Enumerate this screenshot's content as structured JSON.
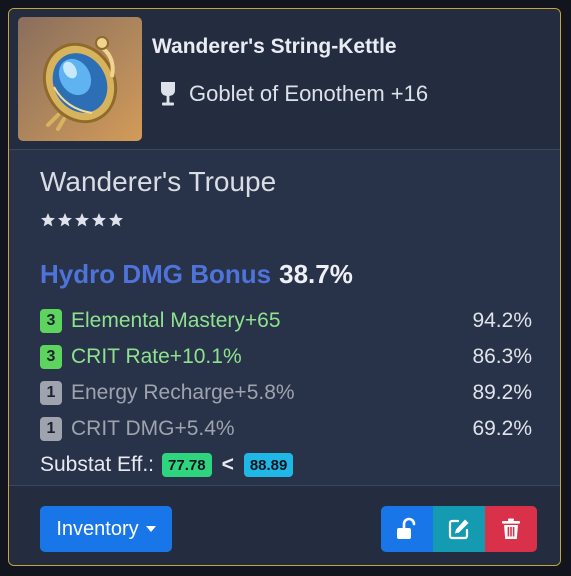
{
  "artifact": {
    "name": "Wanderer's String-Kettle",
    "slot": "Goblet of Eonothem +16",
    "slot_icon": "goblet-icon",
    "image_icon": "artifact-goblet-image",
    "set": "Wanderer's Troupe",
    "rarity_stars": 5,
    "main_stat": {
      "name": "Hydro DMG Bonus",
      "value": "38.7%",
      "color": "#4f74d9"
    },
    "substats": [
      {
        "rolls": "3",
        "text": "Elemental Mastery+65",
        "pct": "94.2%",
        "tier": "high"
      },
      {
        "rolls": "3",
        "text": "CRIT Rate+10.1%",
        "pct": "86.3%",
        "tier": "high"
      },
      {
        "rolls": "1",
        "text": "Energy Recharge+5.8%",
        "pct": "89.2%",
        "tier": "low"
      },
      {
        "rolls": "1",
        "text": "CRIT DMG+5.4%",
        "pct": "69.2%",
        "tier": "low"
      }
    ],
    "efficiency": {
      "label": "Substat Eff.:",
      "current": "77.78",
      "comparator": "<",
      "max": "88.89"
    }
  },
  "footer": {
    "location_button": "Inventory",
    "actions": [
      {
        "icon": "unlock-icon",
        "color": "#1976e8"
      },
      {
        "icon": "edit-icon",
        "color": "#149bb1"
      },
      {
        "icon": "trash-icon",
        "color": "#d9314a"
      }
    ]
  },
  "colors": {
    "border": "#c9a43a",
    "card_body": "#283249",
    "card_header": "#242d40",
    "roll_high": "#5dd45d",
    "roll_low": "#9ea3ad"
  }
}
